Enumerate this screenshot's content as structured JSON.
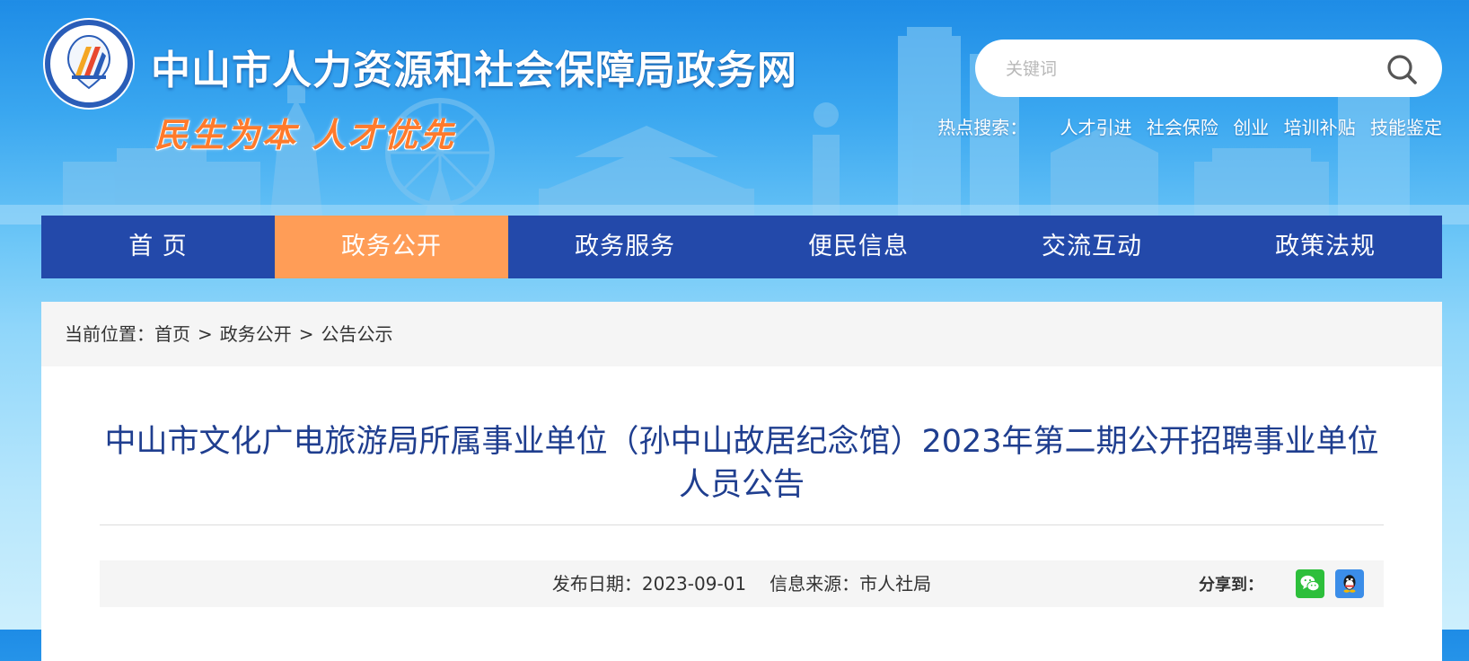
{
  "header": {
    "site_title": "中山市人力资源和社会保障局政务网",
    "slogan": "民生为本 人才优先",
    "logo_icon": "hrss-emblem-logo"
  },
  "search": {
    "placeholder": "关键词",
    "button_icon": "search-icon",
    "hot_label": "热点搜索：",
    "hot_links": [
      "人才引进",
      "社会保险",
      "创业",
      "培训补贴",
      "技能鉴定"
    ]
  },
  "nav": {
    "items": [
      "首 页",
      "政务公开",
      "政务服务",
      "便民信息",
      "交流互动",
      "政策法规"
    ],
    "active": "政务公开"
  },
  "breadcrumb": {
    "prefix": "当前位置：",
    "items": [
      "首页",
      "政务公开",
      "公告公示"
    ],
    "separator": ">"
  },
  "article": {
    "title": "中山市文化广电旅游局所属事业单位（孙中山故居纪念馆）2023年第二期公开招聘事业单位人员公告",
    "publish_label": "发布日期：",
    "publish_date": "2023-09-01",
    "source_label": "信息来源：",
    "source": "市人社局"
  },
  "share": {
    "label": "分享到：",
    "icons": [
      "wechat-icon",
      "qq-icon"
    ]
  },
  "colors": {
    "nav_bg": "#2349aa",
    "nav_active": "#ff9d57",
    "title_blue": "#1f3e8f",
    "slogan_orange": "#ff7a2b"
  }
}
